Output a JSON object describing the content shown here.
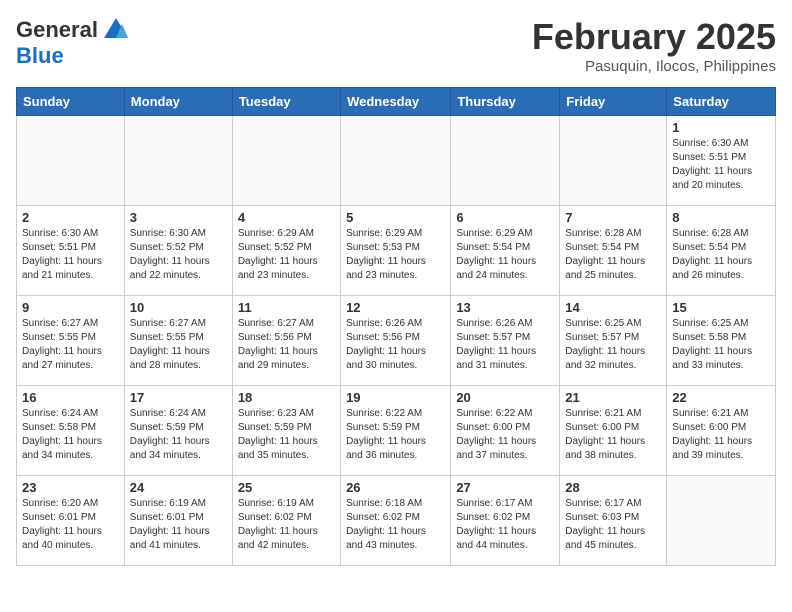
{
  "logo": {
    "general": "General",
    "blue": "Blue"
  },
  "header": {
    "title": "February 2025",
    "subtitle": "Pasuquin, Ilocos, Philippines"
  },
  "weekdays": [
    "Sunday",
    "Monday",
    "Tuesday",
    "Wednesday",
    "Thursday",
    "Friday",
    "Saturday"
  ],
  "weeks": [
    [
      {
        "day": "",
        "info": ""
      },
      {
        "day": "",
        "info": ""
      },
      {
        "day": "",
        "info": ""
      },
      {
        "day": "",
        "info": ""
      },
      {
        "day": "",
        "info": ""
      },
      {
        "day": "",
        "info": ""
      },
      {
        "day": "1",
        "info": "Sunrise: 6:30 AM\nSunset: 5:51 PM\nDaylight: 11 hours and 20 minutes."
      }
    ],
    [
      {
        "day": "2",
        "info": "Sunrise: 6:30 AM\nSunset: 5:51 PM\nDaylight: 11 hours and 21 minutes."
      },
      {
        "day": "3",
        "info": "Sunrise: 6:30 AM\nSunset: 5:52 PM\nDaylight: 11 hours and 22 minutes."
      },
      {
        "day": "4",
        "info": "Sunrise: 6:29 AM\nSunset: 5:52 PM\nDaylight: 11 hours and 23 minutes."
      },
      {
        "day": "5",
        "info": "Sunrise: 6:29 AM\nSunset: 5:53 PM\nDaylight: 11 hours and 23 minutes."
      },
      {
        "day": "6",
        "info": "Sunrise: 6:29 AM\nSunset: 5:54 PM\nDaylight: 11 hours and 24 minutes."
      },
      {
        "day": "7",
        "info": "Sunrise: 6:28 AM\nSunset: 5:54 PM\nDaylight: 11 hours and 25 minutes."
      },
      {
        "day": "8",
        "info": "Sunrise: 6:28 AM\nSunset: 5:54 PM\nDaylight: 11 hours and 26 minutes."
      }
    ],
    [
      {
        "day": "9",
        "info": "Sunrise: 6:27 AM\nSunset: 5:55 PM\nDaylight: 11 hours and 27 minutes."
      },
      {
        "day": "10",
        "info": "Sunrise: 6:27 AM\nSunset: 5:55 PM\nDaylight: 11 hours and 28 minutes."
      },
      {
        "day": "11",
        "info": "Sunrise: 6:27 AM\nSunset: 5:56 PM\nDaylight: 11 hours and 29 minutes."
      },
      {
        "day": "12",
        "info": "Sunrise: 6:26 AM\nSunset: 5:56 PM\nDaylight: 11 hours and 30 minutes."
      },
      {
        "day": "13",
        "info": "Sunrise: 6:26 AM\nSunset: 5:57 PM\nDaylight: 11 hours and 31 minutes."
      },
      {
        "day": "14",
        "info": "Sunrise: 6:25 AM\nSunset: 5:57 PM\nDaylight: 11 hours and 32 minutes."
      },
      {
        "day": "15",
        "info": "Sunrise: 6:25 AM\nSunset: 5:58 PM\nDaylight: 11 hours and 33 minutes."
      }
    ],
    [
      {
        "day": "16",
        "info": "Sunrise: 6:24 AM\nSunset: 5:58 PM\nDaylight: 11 hours and 34 minutes."
      },
      {
        "day": "17",
        "info": "Sunrise: 6:24 AM\nSunset: 5:59 PM\nDaylight: 11 hours and 34 minutes."
      },
      {
        "day": "18",
        "info": "Sunrise: 6:23 AM\nSunset: 5:59 PM\nDaylight: 11 hours and 35 minutes."
      },
      {
        "day": "19",
        "info": "Sunrise: 6:22 AM\nSunset: 5:59 PM\nDaylight: 11 hours and 36 minutes."
      },
      {
        "day": "20",
        "info": "Sunrise: 6:22 AM\nSunset: 6:00 PM\nDaylight: 11 hours and 37 minutes."
      },
      {
        "day": "21",
        "info": "Sunrise: 6:21 AM\nSunset: 6:00 PM\nDaylight: 11 hours and 38 minutes."
      },
      {
        "day": "22",
        "info": "Sunrise: 6:21 AM\nSunset: 6:00 PM\nDaylight: 11 hours and 39 minutes."
      }
    ],
    [
      {
        "day": "23",
        "info": "Sunrise: 6:20 AM\nSunset: 6:01 PM\nDaylight: 11 hours and 40 minutes."
      },
      {
        "day": "24",
        "info": "Sunrise: 6:19 AM\nSunset: 6:01 PM\nDaylight: 11 hours and 41 minutes."
      },
      {
        "day": "25",
        "info": "Sunrise: 6:19 AM\nSunset: 6:02 PM\nDaylight: 11 hours and 42 minutes."
      },
      {
        "day": "26",
        "info": "Sunrise: 6:18 AM\nSunset: 6:02 PM\nDaylight: 11 hours and 43 minutes."
      },
      {
        "day": "27",
        "info": "Sunrise: 6:17 AM\nSunset: 6:02 PM\nDaylight: 11 hours and 44 minutes."
      },
      {
        "day": "28",
        "info": "Sunrise: 6:17 AM\nSunset: 6:03 PM\nDaylight: 11 hours and 45 minutes."
      },
      {
        "day": "",
        "info": ""
      }
    ]
  ]
}
